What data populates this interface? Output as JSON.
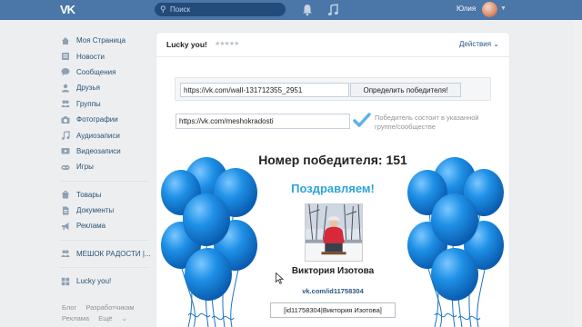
{
  "topbar": {
    "logo": "VK",
    "search_placeholder": "Поиск",
    "user_name": "Юлия"
  },
  "sidebar": {
    "items": [
      {
        "label": "Моя Страница",
        "icon": "home-icon"
      },
      {
        "label": "Новости",
        "icon": "news-icon"
      },
      {
        "label": "Сообщения",
        "icon": "messages-icon"
      },
      {
        "label": "Друзья",
        "icon": "friends-icon"
      },
      {
        "label": "Группы",
        "icon": "groups-icon"
      },
      {
        "label": "Фотографии",
        "icon": "camera-icon"
      },
      {
        "label": "Аудиозаписи",
        "icon": "music-icon"
      },
      {
        "label": "Видеозаписи",
        "icon": "video-icon"
      },
      {
        "label": "Игры",
        "icon": "games-icon"
      },
      {
        "label": "Товары",
        "icon": "goods-icon"
      },
      {
        "label": "Документы",
        "icon": "documents-icon"
      },
      {
        "label": "Реклама",
        "icon": "ads-icon"
      },
      {
        "label": "МЕШОК РАДОСТИ |...",
        "icon": "community-icon"
      },
      {
        "label": "Lucky you!",
        "icon": "app-icon"
      }
    ],
    "footer": {
      "blog": "Блог",
      "developers": "Разработчикам",
      "ads": "Реклама",
      "more": "Ещё"
    }
  },
  "app": {
    "title": "Lucky you!",
    "rating_stars": "★★★★★",
    "actions_label": "Действия"
  },
  "form": {
    "post_url": "https://vk.com/wall-131712355_2951",
    "determine_button": "Определить победителя!",
    "group_url": "https://vk.com/meshokradosti",
    "condition_text": "Победитель состоит в указанной группе/сообществе"
  },
  "result": {
    "winner_number_label": "Номер победителя: 151",
    "congrats": "Поздравляем!",
    "winner_name": "Виктория Изотова",
    "winner_link": "vk.com/id11758304",
    "winner_code": "[id11758304|Виктория Изотова]"
  },
  "colors": {
    "header": "#4a76a8",
    "link": "#285473",
    "accent": "#2fa3d8",
    "balloon": "#1e90e6"
  }
}
